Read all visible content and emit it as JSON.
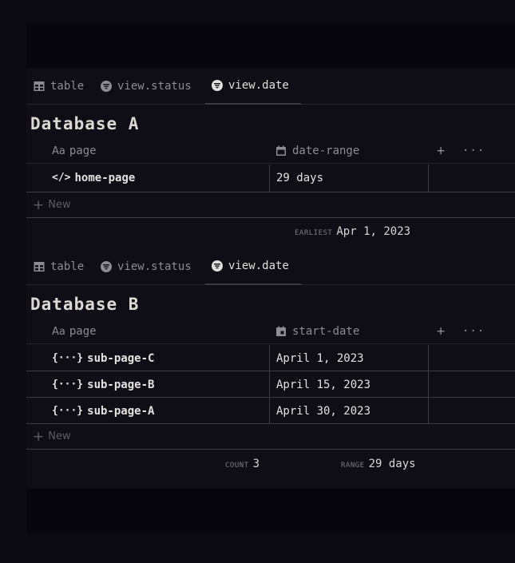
{
  "databases": [
    {
      "tabs": [
        {
          "label": "table",
          "icon": "table-icon"
        },
        {
          "label": "view.status",
          "icon": "filter-icon"
        },
        {
          "label": "view.date",
          "icon": "filter-icon",
          "active": true
        }
      ],
      "title": "Database A",
      "header": {
        "col1_prefix": "Aa",
        "col1": "page",
        "col2": "date-range",
        "add": "+",
        "more": "···"
      },
      "rows": [
        {
          "icon": "</>",
          "name": "home-page",
          "value": "29 days"
        }
      ],
      "new_label": "New",
      "calcs": [
        {
          "label": "EARLIEST",
          "value": "Apr 1, 2023"
        }
      ]
    },
    {
      "tabs": [
        {
          "label": "table",
          "icon": "table-icon"
        },
        {
          "label": "view.status",
          "icon": "filter-icon"
        },
        {
          "label": "view.date",
          "icon": "filter-icon",
          "active": true
        }
      ],
      "title": "Database B",
      "header": {
        "col1_prefix": "Aa",
        "col1": "page",
        "col2": "start-date",
        "add": "+",
        "more": "···"
      },
      "rows": [
        {
          "icon": "{···}",
          "name": "sub-page-C",
          "value": "April 1, 2023"
        },
        {
          "icon": "{···}",
          "name": "sub-page-B",
          "value": "April 15, 2023"
        },
        {
          "icon": "{···}",
          "name": "sub-page-A",
          "value": "April 30, 2023"
        }
      ],
      "new_label": "New",
      "calcs": [
        {
          "label": "COUNT",
          "value": "3"
        },
        {
          "label": "RANGE",
          "value": "29 days"
        }
      ]
    }
  ]
}
